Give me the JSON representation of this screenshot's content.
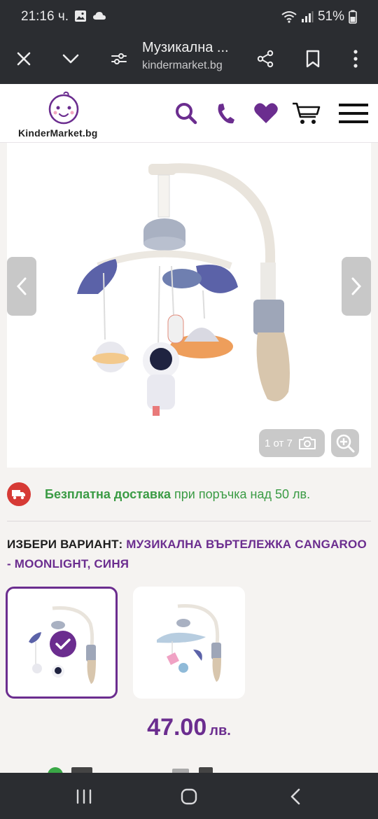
{
  "status_bar": {
    "time": "21:16 ч.",
    "battery": "51%"
  },
  "browser": {
    "page_title": "Музикална ...",
    "url": "kindermarket.bg"
  },
  "site": {
    "logo_text": "KinderMarket.bg",
    "brand_color": "#6b2d8f"
  },
  "gallery": {
    "counter": "1 от 7"
  },
  "delivery": {
    "bold_text": "Безплатна доставка",
    "rest_text": " при поръчка над 50 лв."
  },
  "variant": {
    "label": "ИЗБЕРИ ВАРИАНТ: ",
    "value": "МУЗИКАЛНА ВЪРТЕЛЕЖКА CANGAROO - MOONLIGHT, СИНЯ"
  },
  "price": {
    "amount": "47.00",
    "currency": "лв."
  }
}
